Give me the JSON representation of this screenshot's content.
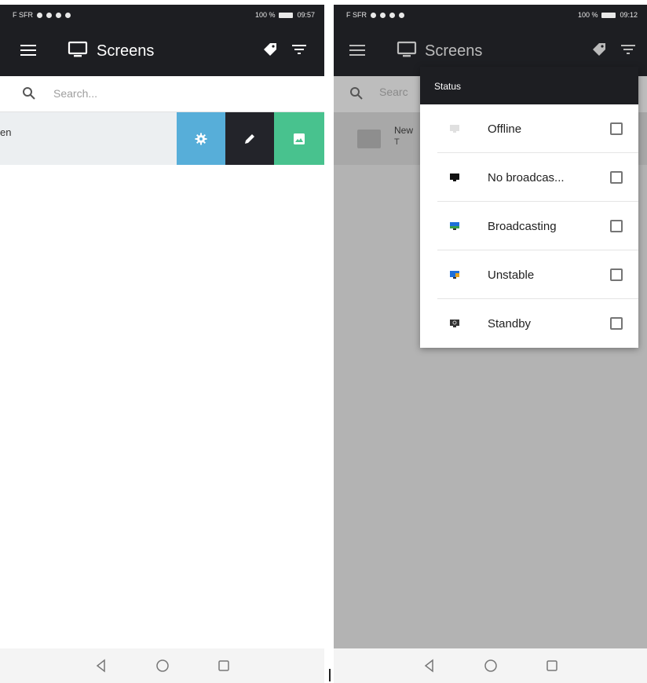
{
  "colors": {
    "appbar": "#1d1e22",
    "settings_action": "#57aed9",
    "edit_action": "#23242a",
    "image_action": "#48c28e",
    "scrim": "#b3b3b3"
  },
  "left": {
    "status": {
      "time": "09:57",
      "battery": "100 %",
      "carrier": "F SFR"
    },
    "appbar": {
      "title": "Screens",
      "icons": [
        "menu-icon",
        "screen-icon",
        "tag-icon",
        "filter-icon"
      ]
    },
    "search": {
      "placeholder": "Search..."
    },
    "row": {
      "visible_text": "en",
      "actions": [
        "gear-icon",
        "pencil-icon",
        "image-icon"
      ]
    },
    "nav": [
      "back-icon",
      "home-icon",
      "recents-icon"
    ]
  },
  "right": {
    "status": {
      "time": "09:12",
      "battery": "100 %",
      "carrier": "F SFR"
    },
    "appbar": {
      "title": "Screens"
    },
    "search": {
      "placeholder": "Searc"
    },
    "row": {
      "title": "New",
      "sub": "T"
    },
    "dropdown": {
      "header": "Status",
      "items": [
        {
          "label": "Offline",
          "icon": "monitor-offline-icon",
          "checked": false
        },
        {
          "label": "No broadcas...",
          "icon": "monitor-no-broadcast-icon",
          "checked": false
        },
        {
          "label": "Broadcasting",
          "icon": "monitor-broadcasting-icon",
          "checked": false
        },
        {
          "label": "Unstable",
          "icon": "monitor-unstable-icon",
          "checked": false
        },
        {
          "label": "Standby",
          "icon": "monitor-standby-icon",
          "checked": false
        }
      ]
    },
    "nav": [
      "back-icon",
      "home-icon",
      "recents-icon"
    ]
  }
}
